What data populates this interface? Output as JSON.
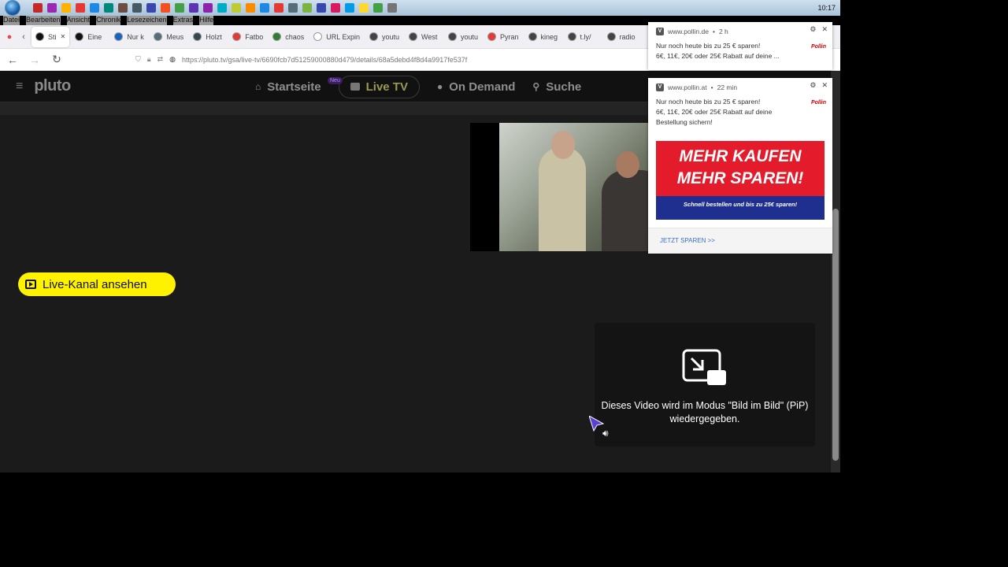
{
  "taskbar": {
    "clock": "10:17",
    "icon_colors": [
      "#c62828",
      "#9c27b0",
      "#ffb300",
      "#e53935",
      "#1e88e5",
      "#00897b",
      "#6d4c41",
      "#455a64",
      "#3949ab",
      "#f4511e",
      "#43a047",
      "#5e35b1",
      "#8e24aa",
      "#00acc1",
      "#c0ca33",
      "#fb8c00",
      "#1e88e5",
      "#e53935",
      "#546e7a",
      "#7cb342",
      "#3949ab",
      "#d81b60",
      "#039be5",
      "#fdd835",
      "#43a047",
      "#757575"
    ]
  },
  "menubar": {
    "items": [
      "Datei",
      "Bearbeiten",
      "Ansicht",
      "Chronik",
      "Lesezeichen",
      "Extras",
      "Hilfe"
    ]
  },
  "browser": {
    "tabs": [
      {
        "label": "Sti",
        "favicon_color": "#111111",
        "active": true
      },
      {
        "label": "Eine",
        "favicon_color": "#111111"
      },
      {
        "label": "Nur k",
        "favicon_color": "#1565c0"
      },
      {
        "label": "Meus",
        "favicon_color": "#546e7a"
      },
      {
        "label": "Holzt",
        "favicon_color": "#37474f"
      },
      {
        "label": "Fatbo",
        "favicon_color": "#e53935"
      },
      {
        "label": "chaos",
        "favicon_color": "#2e7d32"
      },
      {
        "label": "URL Expin",
        "favicon_color": "#ffffff"
      },
      {
        "label": "youtu",
        "favicon_color": "#444444"
      },
      {
        "label": "West",
        "favicon_color": "#444444"
      },
      {
        "label": "youtu",
        "favicon_color": "#444444"
      },
      {
        "label": "Pyran",
        "favicon_color": "#e53935"
      },
      {
        "label": "kineg",
        "favicon_color": "#444444"
      },
      {
        "label": "t.ly/",
        "favicon_color": "#444444"
      },
      {
        "label": "radio",
        "favicon_color": "#444444"
      }
    ],
    "url": "https://pluto.tv/gsa/live-tv/6690fcb7d51259000880d479/details/68a5debd4f8d4a9917fe537f"
  },
  "pluto": {
    "logo": "pluto",
    "nav": {
      "home": "Startseite",
      "live": "Live TV",
      "ondemand": "On Demand",
      "search": "Suche",
      "badge": "Neu"
    },
    "live_button_label": "Live-Kanal ansehen",
    "pip_message": "Dieses Video wird im Modus \"Bild im Bild\" (PiP) wiedergegeben."
  },
  "notifications": [
    {
      "site": "www.pollin.de",
      "time": "2 h",
      "title": "Nur noch heute bis zu 25 € sparen!",
      "body": "6€, 11€, 20€ oder 25€ Rabatt auf deine ...",
      "logo": "Pollin"
    },
    {
      "site": "www.pollin.at",
      "time": "22 min",
      "title": "Nur noch heute bis zu 25 € sparen!",
      "body": "6€, 11€, 20€ oder 25€ Rabatt auf deine Bestellung sichern!",
      "logo": "Pollin",
      "ad_line1": "MEHR KAUFEN",
      "ad_line2": "MEHR SPAREN!",
      "ad_sub": "Schnell bestellen und bis zu 25€ sparen!",
      "cta": "JETZT SPAREN >>"
    }
  ]
}
